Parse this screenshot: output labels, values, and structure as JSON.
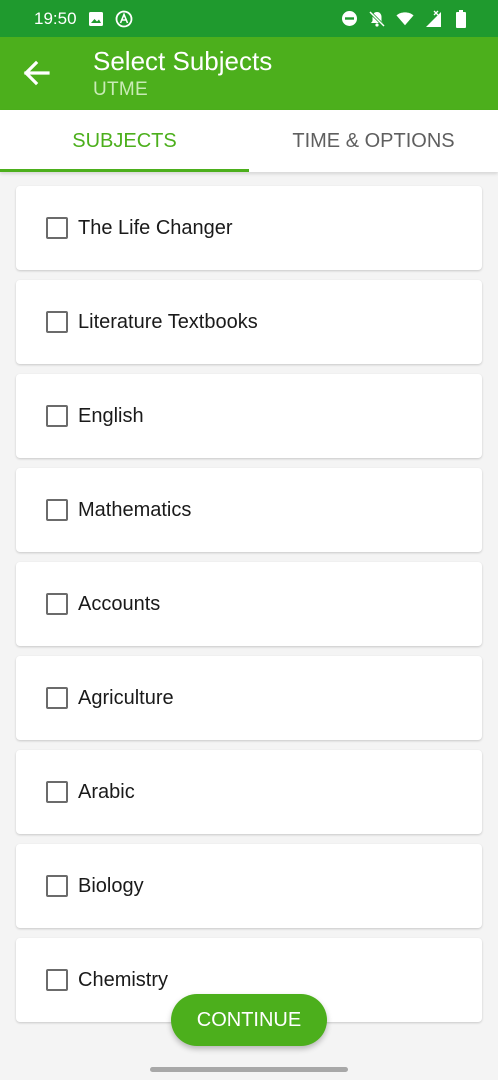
{
  "status_bar": {
    "time": "19:50",
    "left_icons": [
      "image-icon",
      "a-circle-icon"
    ],
    "right_icons": [
      "dnd-icon",
      "bell-off-icon",
      "wifi-icon",
      "signal-icon",
      "battery-icon"
    ]
  },
  "app_bar": {
    "title": "Select Subjects",
    "subtitle": "UTME"
  },
  "tabs": [
    {
      "label": "SUBJECTS",
      "active": true
    },
    {
      "label": "TIME & OPTIONS",
      "active": false
    }
  ],
  "subjects": [
    {
      "label": "The Life Changer",
      "checked": false
    },
    {
      "label": "Literature Textbooks",
      "checked": false
    },
    {
      "label": "English",
      "checked": false
    },
    {
      "label": "Mathematics",
      "checked": false
    },
    {
      "label": "Accounts",
      "checked": false
    },
    {
      "label": "Agriculture",
      "checked": false
    },
    {
      "label": "Arabic",
      "checked": false
    },
    {
      "label": "Biology",
      "checked": false
    },
    {
      "label": "Chemistry",
      "checked": false
    }
  ],
  "continue_label": "CONTINUE",
  "colors": {
    "status_bar": "#1f9a2e",
    "primary": "#4caf1c",
    "background": "#f4f4f4"
  }
}
